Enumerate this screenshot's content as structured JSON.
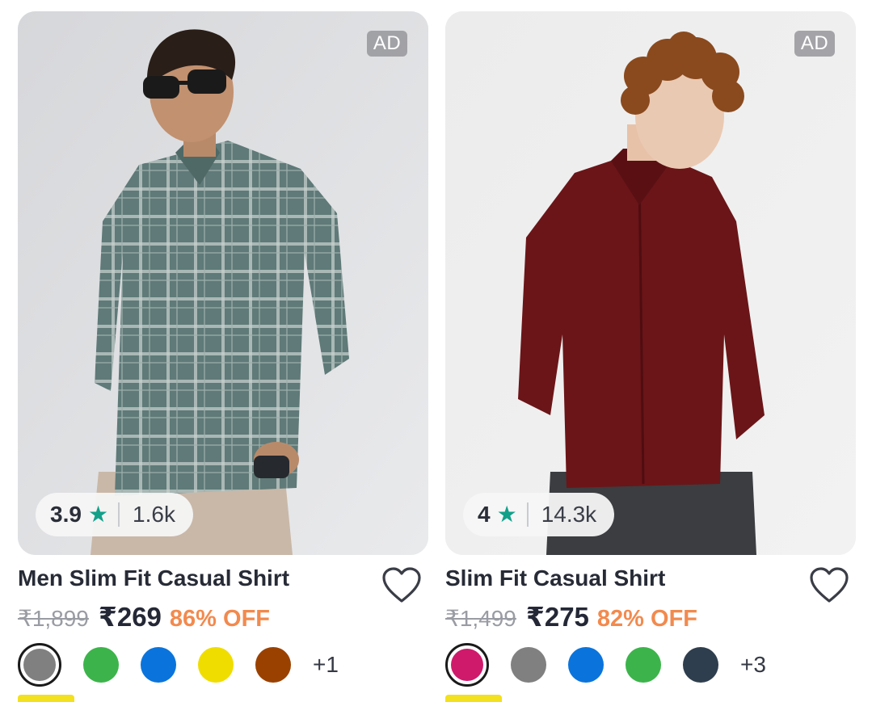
{
  "products": [
    {
      "ad_label": "AD",
      "rating": "3.9",
      "rating_count": "1.6k",
      "star_icon": "star-icon",
      "title": "Men Slim Fit Casual Shirt",
      "mrp": "₹1,899",
      "price": "₹269",
      "discount": "86% OFF",
      "wishlist_icon": "heart-outline-icon",
      "swatches": [
        "#808080",
        "#3cb44b",
        "#0a74dc",
        "#f0dd00",
        "#9a4100"
      ],
      "selected_swatch": 0,
      "more_colors": "+1"
    },
    {
      "ad_label": "AD",
      "rating": "4",
      "rating_count": "14.3k",
      "star_icon": "star-icon",
      "title": "Slim Fit Casual Shirt",
      "mrp": "₹1,499",
      "price": "₹275",
      "discount": "82% OFF",
      "wishlist_icon": "heart-outline-icon",
      "swatches": [
        "#cf1a6b",
        "#808080",
        "#0a74dc",
        "#3cb44b",
        "#2f3e4e"
      ],
      "selected_swatch": 0,
      "more_colors": "+3"
    }
  ],
  "colors": {
    "star": "#12a089",
    "discount": "#f28a4e",
    "promo_strip": "#f3e01e"
  }
}
